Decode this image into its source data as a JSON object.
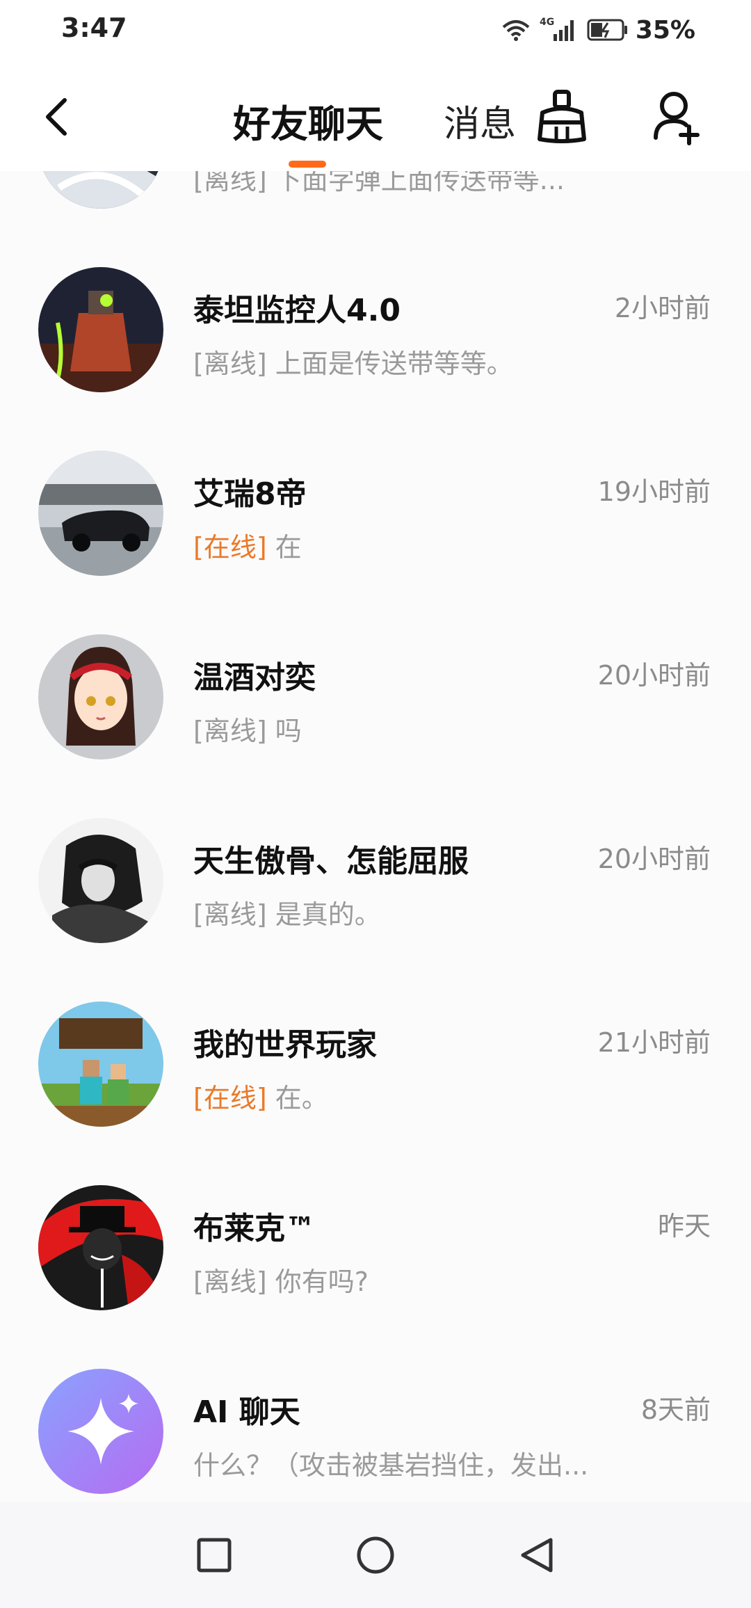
{
  "status_bar": {
    "time": "3:47",
    "network": "4G",
    "battery": "35%"
  },
  "header": {
    "title": "好友聊天",
    "secondary_tab": "消息"
  },
  "chats": [
    {
      "name": "",
      "time": "",
      "status": "[离线]",
      "status_type": "offline",
      "message": "下面字弹上面传送带等..."
    },
    {
      "name": "泰坦监控人4.0",
      "time": "2小时前",
      "status": "[离线]",
      "status_type": "offline",
      "message": "上面是传送带等等。"
    },
    {
      "name": "艾瑞8帝",
      "time": "19小时前",
      "status": "[在线]",
      "status_type": "online",
      "message": "在"
    },
    {
      "name": "温酒对奕",
      "time": "20小时前",
      "status": "[离线]",
      "status_type": "offline",
      "message": "吗"
    },
    {
      "name": "天生傲骨、怎能屈服",
      "time": "20小时前",
      "status": "[离线]",
      "status_type": "offline",
      "message": "是真的。"
    },
    {
      "name": "我的世界玩家",
      "time": "21小时前",
      "status": "[在线]",
      "status_type": "online",
      "message": "在。"
    },
    {
      "name": "布莱克™",
      "time": "昨天",
      "status": "[离线]",
      "status_type": "offline",
      "message": "你有吗?"
    },
    {
      "name": "AI 聊天",
      "time": "8天前",
      "status": "",
      "status_type": "",
      "message": "什么？（攻击被基岩挡住，发出..."
    }
  ],
  "icons": {
    "back": "back-arrow-icon",
    "clean": "clean-broom-icon",
    "add_friend": "add-friend-icon",
    "wifi": "wifi-icon",
    "signal": "signal-icon",
    "battery": "battery-icon",
    "recent": "square-nav-icon",
    "home": "circle-nav-icon",
    "back_nav": "triangle-nav-icon"
  },
  "colors": {
    "accent": "#ff6a1a",
    "online": "#ea7a2a",
    "muted": "#9a9a9a"
  }
}
